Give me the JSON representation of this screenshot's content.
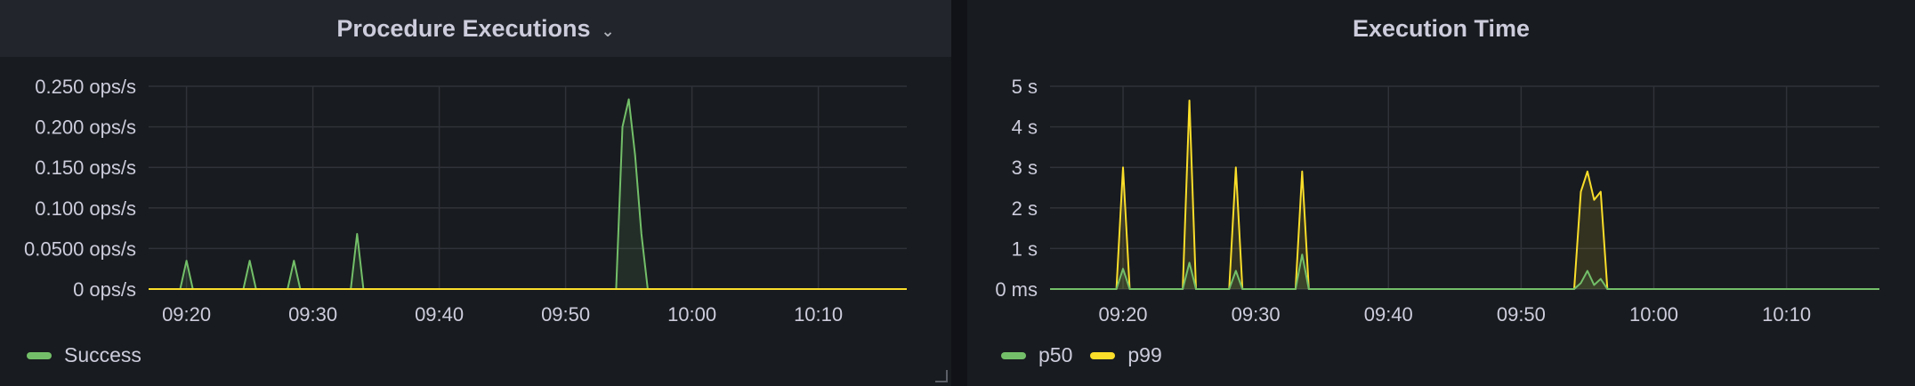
{
  "colors": {
    "success": "#73bf69",
    "p50": "#73bf69",
    "p99": "#fade2a",
    "grid": "#2f3238",
    "text": "#ccccdc"
  },
  "left_panel": {
    "title": "Procedure Executions",
    "menu_icon": "chevron-down-icon",
    "legend": [
      {
        "label": "Success",
        "color": "#73bf69"
      }
    ]
  },
  "right_panel": {
    "title": "Execution Time",
    "legend": [
      {
        "label": "p50",
        "color": "#73bf69"
      },
      {
        "label": "p99",
        "color": "#fade2a"
      }
    ]
  },
  "chart_data": [
    {
      "type": "area",
      "title": "Procedure Executions",
      "x_ticks": [
        "09:20",
        "09:30",
        "09:40",
        "09:50",
        "10:00",
        "10:10"
      ],
      "x_range": [
        "09:17",
        "10:17"
      ],
      "y_ticks": [
        "0 ops/s",
        "0.0500 ops/s",
        "0.100 ops/s",
        "0.150 ops/s",
        "0.200 ops/s",
        "0.250 ops/s"
      ],
      "y_range": [
        0,
        0.25
      ],
      "series": [
        {
          "name": "Success",
          "color": "#73bf69",
          "points": [
            [
              "09:17",
              0
            ],
            [
              "09:19.5",
              0
            ],
            [
              "09:20",
              0.035
            ],
            [
              "09:20.5",
              0
            ],
            [
              "09:24.5",
              0
            ],
            [
              "09:25",
              0.035
            ],
            [
              "09:25.5",
              0
            ],
            [
              "09:28",
              0
            ],
            [
              "09:28.5",
              0.035
            ],
            [
              "09:29",
              0
            ],
            [
              "09:33",
              0
            ],
            [
              "09:33.5",
              0.068
            ],
            [
              "09:34",
              0
            ],
            [
              "09:54",
              0
            ],
            [
              "09:54.5",
              0.2
            ],
            [
              "09:55",
              0.234
            ],
            [
              "09:55.5",
              0.165
            ],
            [
              "09:56",
              0.068
            ],
            [
              "09:56.5",
              0
            ],
            [
              "10:17",
              0
            ]
          ]
        },
        {
          "name": "",
          "color": "#fade2a",
          "points": [
            [
              "09:17",
              0
            ],
            [
              "10:17",
              0
            ]
          ]
        }
      ]
    },
    {
      "type": "area",
      "title": "Execution Time",
      "x_ticks": [
        "09:20",
        "09:30",
        "09:40",
        "09:50",
        "10:00",
        "10:10"
      ],
      "x_range": [
        "09:14.5",
        "10:17"
      ],
      "y_ticks": [
        "0 ms",
        "1 s",
        "2 s",
        "3 s",
        "4 s",
        "5 s"
      ],
      "y_range": [
        0,
        5
      ],
      "series": [
        {
          "name": "p99",
          "color": "#fade2a",
          "points": [
            [
              "09:14.5",
              0
            ],
            [
              "09:19.5",
              0
            ],
            [
              "09:20",
              3.0
            ],
            [
              "09:20.5",
              0
            ],
            [
              "09:24.5",
              0
            ],
            [
              "09:25",
              4.65
            ],
            [
              "09:25.5",
              0
            ],
            [
              "09:28",
              0
            ],
            [
              "09:28.5",
              3.0
            ],
            [
              "09:29",
              0
            ],
            [
              "09:33",
              0
            ],
            [
              "09:33.5",
              2.9
            ],
            [
              "09:34",
              0
            ],
            [
              "09:54",
              0
            ],
            [
              "09:54.5",
              2.4
            ],
            [
              "09:55",
              2.9
            ],
            [
              "09:55.5",
              2.2
            ],
            [
              "09:56",
              2.4
            ],
            [
              "09:56.5",
              0
            ],
            [
              "10:17",
              0
            ]
          ]
        },
        {
          "name": "p50",
          "color": "#73bf69",
          "points": [
            [
              "09:14.5",
              0
            ],
            [
              "09:19.5",
              0
            ],
            [
              "09:20",
              0.5
            ],
            [
              "09:20.5",
              0
            ],
            [
              "09:24.5",
              0
            ],
            [
              "09:25",
              0.65
            ],
            [
              "09:25.5",
              0
            ],
            [
              "09:28",
              0
            ],
            [
              "09:28.5",
              0.45
            ],
            [
              "09:29",
              0
            ],
            [
              "09:33",
              0
            ],
            [
              "09:33.5",
              0.85
            ],
            [
              "09:34",
              0
            ],
            [
              "09:54",
              0
            ],
            [
              "09:54.5",
              0.15
            ],
            [
              "09:55",
              0.45
            ],
            [
              "09:55.5",
              0.1
            ],
            [
              "09:56",
              0.25
            ],
            [
              "09:56.5",
              0
            ],
            [
              "10:17",
              0
            ]
          ]
        }
      ]
    }
  ]
}
